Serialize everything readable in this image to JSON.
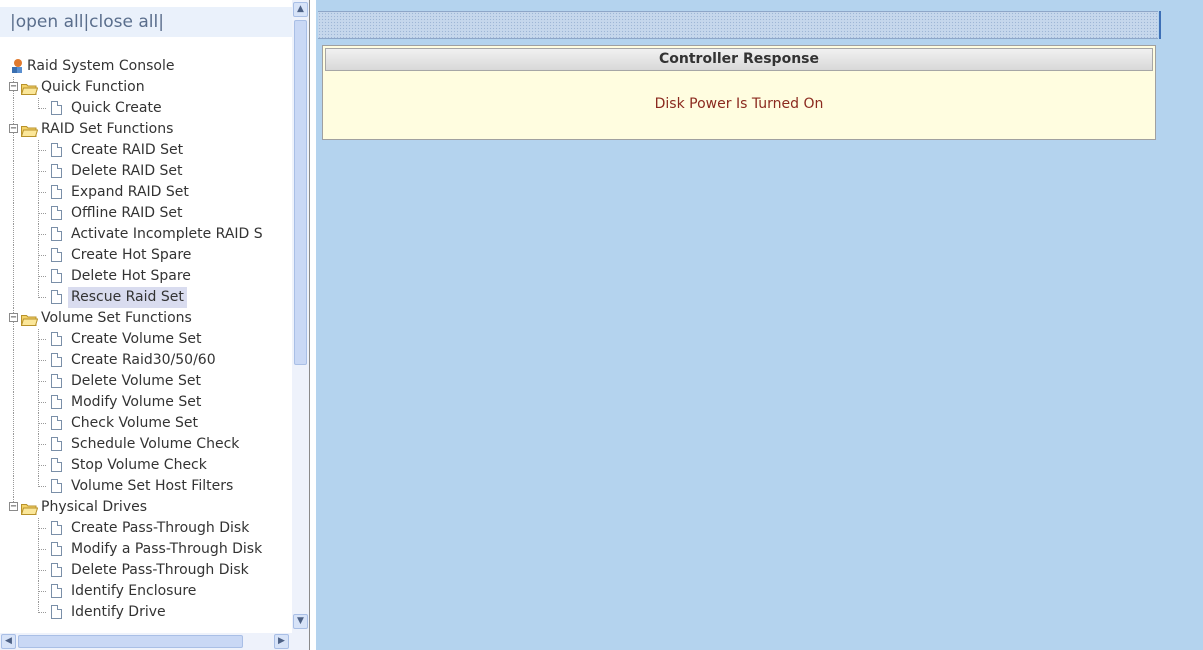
{
  "sidebar": {
    "open_all": "open all",
    "close_all": "close all",
    "root": "Raid System Console",
    "groups": [
      {
        "label": "Quick Function",
        "items": [
          "Quick Create"
        ]
      },
      {
        "label": "RAID Set Functions",
        "items": [
          "Create RAID Set",
          "Delete RAID Set",
          "Expand RAID Set",
          "Offline RAID Set",
          "Activate Incomplete RAID S",
          "Create Hot Spare",
          "Delete Hot Spare",
          "Rescue Raid Set"
        ]
      },
      {
        "label": "Volume Set Functions",
        "items": [
          "Create Volume Set",
          "Create Raid30/50/60",
          "Delete Volume Set",
          "Modify Volume Set",
          "Check Volume Set",
          "Schedule Volume Check",
          "Stop Volume Check",
          "Volume Set Host Filters"
        ]
      },
      {
        "label": "Physical Drives",
        "items": [
          "Create Pass-Through Disk",
          "Modify a Pass-Through Disk",
          "Delete Pass-Through Disk",
          "Identify Enclosure",
          "Identify Drive"
        ]
      }
    ],
    "selected_item": "Rescue Raid Set",
    "folder_icon": "folder-open-icon",
    "item_icon": "document-icon"
  },
  "main": {
    "panel_title": "Controller Response",
    "message": "Disk Power Is Turned On"
  },
  "colors": {
    "main_background": "#b4d3ee",
    "panel_background": "#fffde0",
    "message_text": "#8b2a1f"
  }
}
